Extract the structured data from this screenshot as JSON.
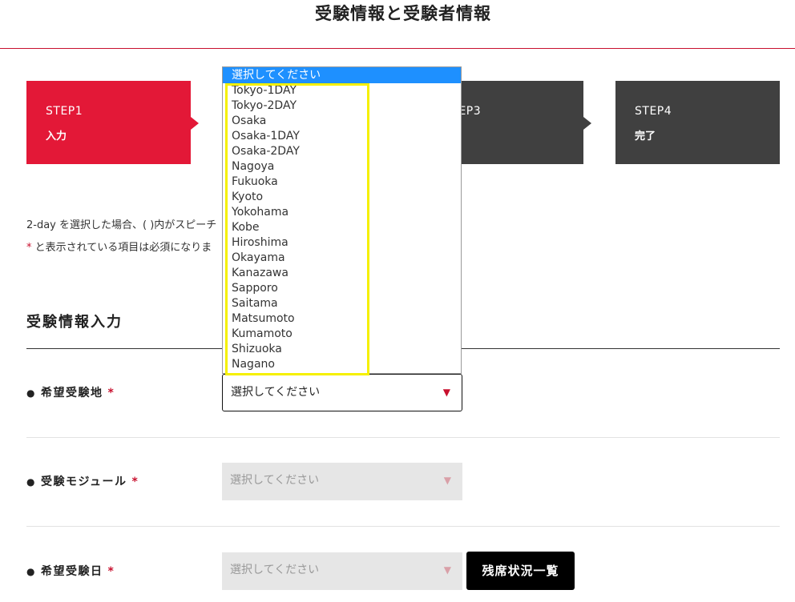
{
  "header": {
    "title": "受験情報と受験者情報"
  },
  "steps": [
    {
      "num": "STEP1",
      "label": "入力"
    },
    {
      "num": "STEP3",
      "label": ""
    },
    {
      "num": "STEP4",
      "label": "完了"
    }
  ],
  "notes": {
    "line1": "2-day を選択した場合、( )内がスピーチ",
    "line2_star": "*",
    "line2_text": " と表示されている項目は必須になりま"
  },
  "section": {
    "title": "受験情報入力"
  },
  "fields": {
    "location": {
      "label": "希望受験地",
      "required": "*",
      "value": "選択してください"
    },
    "module": {
      "label": "受験モジュール",
      "required": "*",
      "value": "選択してください"
    },
    "date": {
      "label": "希望受験日",
      "required": "*",
      "value": "選択してください"
    }
  },
  "buttons": {
    "availability": "残席状況一覧"
  },
  "dropdown": {
    "selected": "選択してください",
    "options": [
      "Tokyo-1DAY",
      "Tokyo-2DAY",
      "Osaka",
      "Osaka-1DAY",
      "Osaka-2DAY",
      "Nagoya",
      "Fukuoka",
      "Kyoto",
      "Yokohama",
      "Kobe",
      "Hiroshima",
      "Okayama",
      "Kanazawa",
      "Sapporo",
      "Saitama",
      "Matsumoto",
      "Kumamoto",
      "Shizuoka",
      "Nagano"
    ]
  },
  "colors": {
    "accent": "#e31837",
    "step_inactive": "#404040",
    "dropdown_selected": "#1e90ff",
    "highlight": "#f5f000"
  },
  "icons": {
    "caret": "caret-down-icon",
    "bullet": "bullet-dot-icon"
  }
}
